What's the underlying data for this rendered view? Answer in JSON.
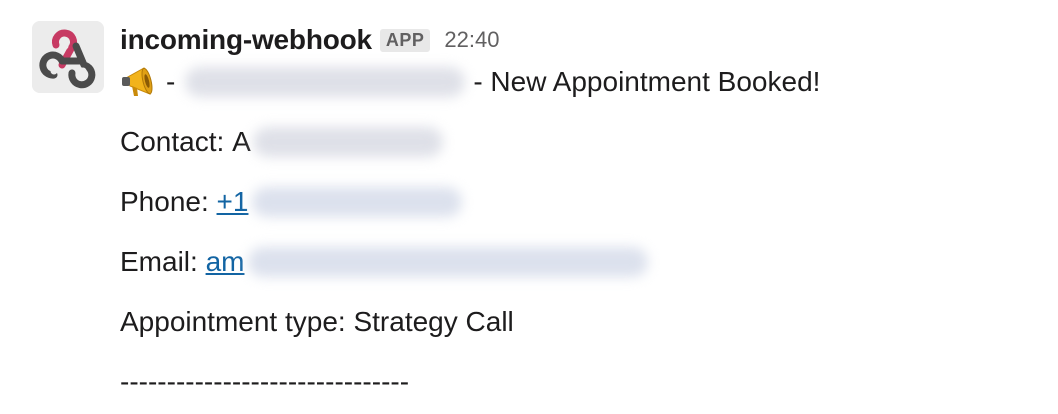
{
  "message": {
    "sender": "incoming-webhook",
    "badge": "APP",
    "time": "22:40",
    "avatar_icon": "webhook-icon",
    "line1": {
      "emoji": "megaphone-icon",
      "prefix": "-",
      "redacted": "[blurred]",
      "suffix": "- New Appointment Booked!"
    },
    "contact": {
      "label": "Contact:",
      "visible_start": "A",
      "redacted": "[blurred]"
    },
    "phone": {
      "label": "Phone:",
      "visible_start": "+1",
      "redacted": "[blurred]"
    },
    "email": {
      "label": "Email:",
      "visible_start": "am",
      "redacted": "[blurred]"
    },
    "appointment": {
      "text": "Appointment type: Strategy Call"
    },
    "divider": "-------------------------------"
  },
  "colors": {
    "link": "#1264a3",
    "text": "#1d1c1d",
    "muted": "#616061",
    "webhook_pink": "#c73a63",
    "webhook_dark": "#4b4b4b"
  }
}
